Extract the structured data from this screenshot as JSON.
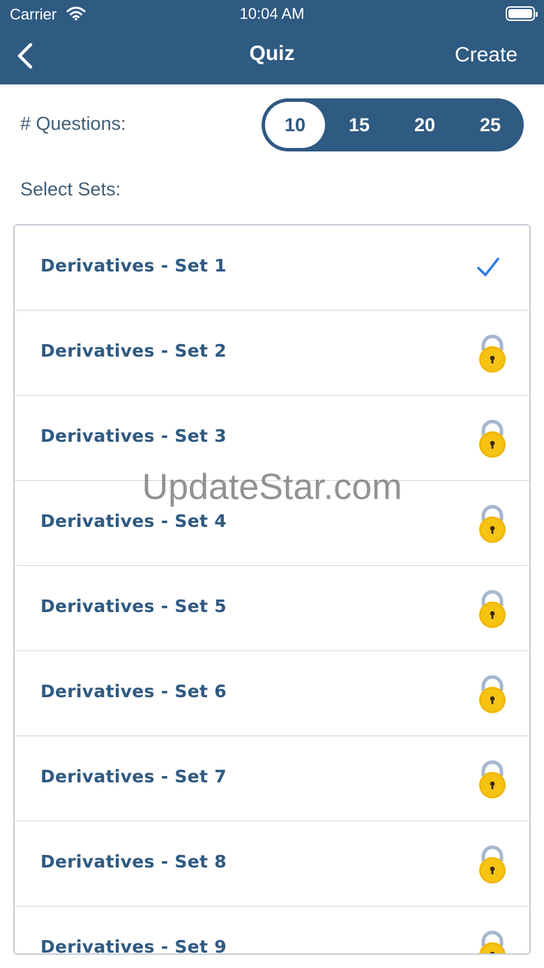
{
  "status_bar": {
    "carrier": "Carrier",
    "time": "10:04 AM"
  },
  "nav": {
    "back_icon": "chevron-left-icon",
    "title": "Quiz",
    "create_label": "Create"
  },
  "questions": {
    "label": "# Questions:",
    "options": [
      "10",
      "15",
      "20",
      "25"
    ],
    "selected": "10"
  },
  "sets": {
    "label": "Select Sets:",
    "items": [
      {
        "label": "Derivatives - Set 1",
        "status": "selected",
        "icon": "checkmark-icon"
      },
      {
        "label": "Derivatives - Set 2",
        "status": "locked",
        "icon": "lock-icon"
      },
      {
        "label": "Derivatives - Set 3",
        "status": "locked",
        "icon": "lock-icon"
      },
      {
        "label": "Derivatives - Set 4",
        "status": "locked",
        "icon": "lock-icon"
      },
      {
        "label": "Derivatives - Set 5",
        "status": "locked",
        "icon": "lock-icon"
      },
      {
        "label": "Derivatives - Set 6",
        "status": "locked",
        "icon": "lock-icon"
      },
      {
        "label": "Derivatives - Set 7",
        "status": "locked",
        "icon": "lock-icon"
      },
      {
        "label": "Derivatives - Set 8",
        "status": "locked",
        "icon": "lock-icon"
      },
      {
        "label": "Derivatives - Set 9",
        "status": "locked",
        "icon": "lock-icon"
      }
    ]
  },
  "watermark": "UpdateStar.com",
  "colors": {
    "header_bg": "#2f5a82",
    "text_primary": "#2f5a82",
    "checkmark": "#2b7de9",
    "lock_body": "#f2b705"
  }
}
